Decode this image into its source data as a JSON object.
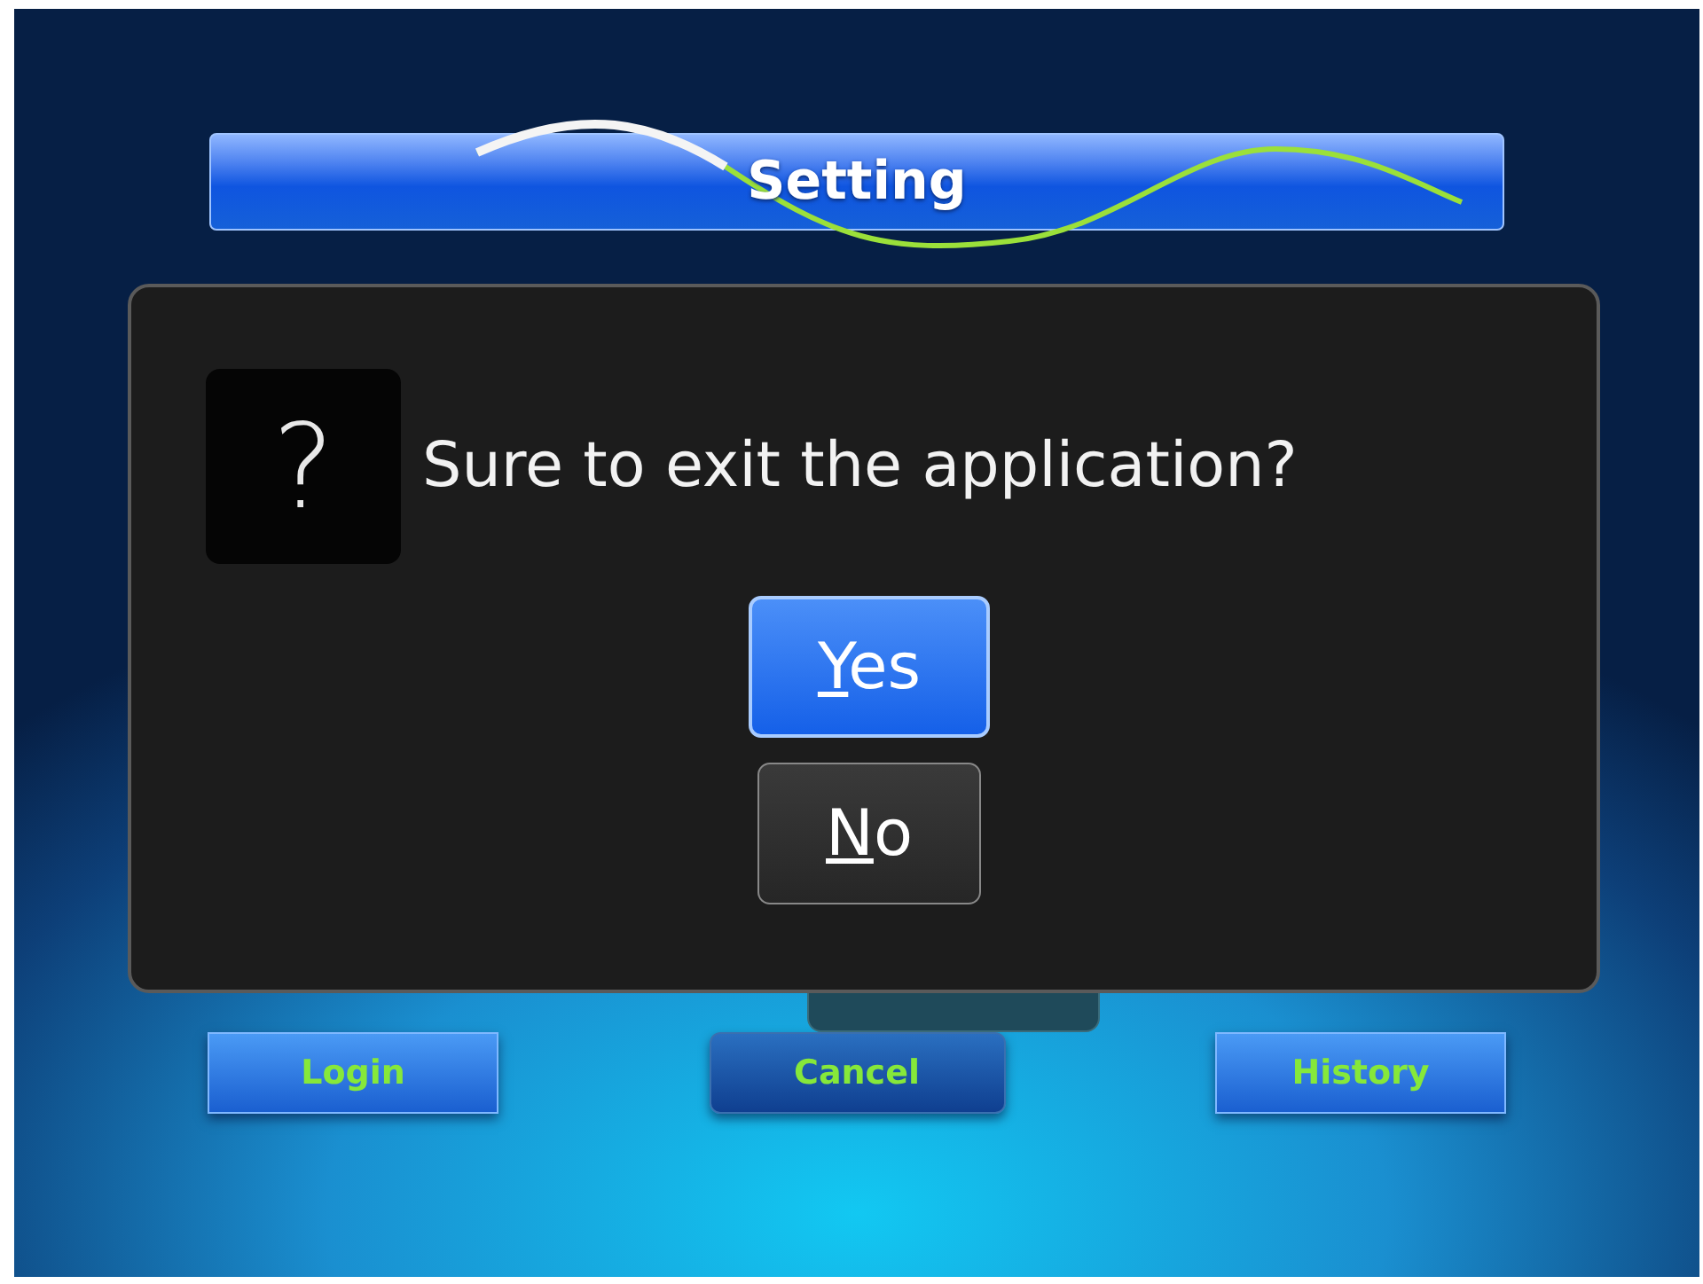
{
  "header": {
    "title": "Setting"
  },
  "dialog": {
    "icon": "?",
    "message": "Sure to exit the application?",
    "buttons": [
      {
        "accel": "Y",
        "rest": "es",
        "selected": true
      },
      {
        "accel": "N",
        "rest": "o",
        "selected": false
      }
    ]
  },
  "footer_buttons": [
    {
      "label": "Login",
      "selected": false
    },
    {
      "label": "Cancel",
      "selected": true
    },
    {
      "label": "History",
      "selected": false
    }
  ]
}
